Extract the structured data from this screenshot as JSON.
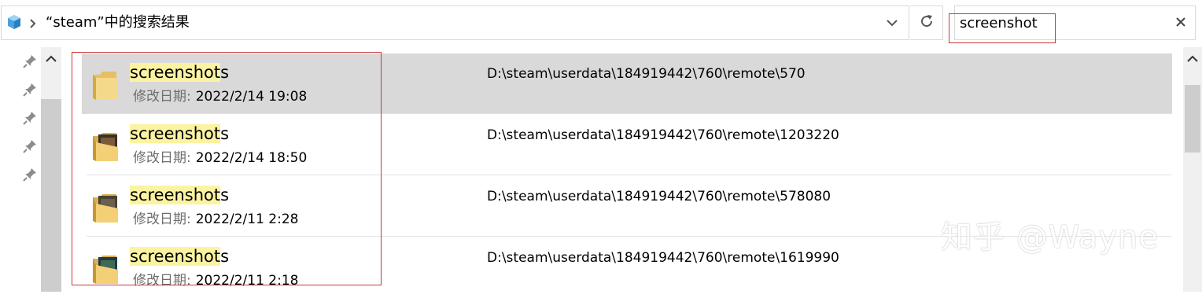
{
  "address_bar": {
    "breadcrumb": "“steam”中的搜索结果",
    "location_icon": "steam-library-icon",
    "separator_icon": "chevron-right-icon",
    "dropdown_icon": "chevron-down-icon",
    "refresh_icon": "refresh-icon"
  },
  "search": {
    "value": "screenshot",
    "clear_icon": "close-icon"
  },
  "nav": {
    "pins": [
      "pin-icon",
      "pin-icon",
      "pin-icon",
      "pin-icon",
      "pin-icon"
    ]
  },
  "results": [
    {
      "name_highlight": "screenshot",
      "name_rest": "s",
      "date_label": "修改日期:",
      "date": "2022/2/14 19:08",
      "path": "D:\\steam\\userdata\\184919442\\760\\remote\\570",
      "selected": true
    },
    {
      "name_highlight": "screenshot",
      "name_rest": "s",
      "date_label": "修改日期:",
      "date": "2022/2/14 18:50",
      "path": "D:\\steam\\userdata\\184919442\\760\\remote\\1203220",
      "selected": false
    },
    {
      "name_highlight": "screenshot",
      "name_rest": "s",
      "date_label": "修改日期:",
      "date": "2022/2/11 2:28",
      "path": "D:\\steam\\userdata\\184919442\\760\\remote\\578080",
      "selected": false
    },
    {
      "name_highlight": "screenshot",
      "name_rest": "s",
      "date_label": "修改日期:",
      "date": "2022/2/11 2:18",
      "path": "D:\\steam\\userdata\\184919442\\760\\remote\\1619990",
      "selected": false
    }
  ],
  "watermark": "知乎 @Wayne",
  "colors": {
    "selection": "#d9d9d9",
    "highlight": "#fbf3a1",
    "annotation_red": "#c8393a"
  }
}
